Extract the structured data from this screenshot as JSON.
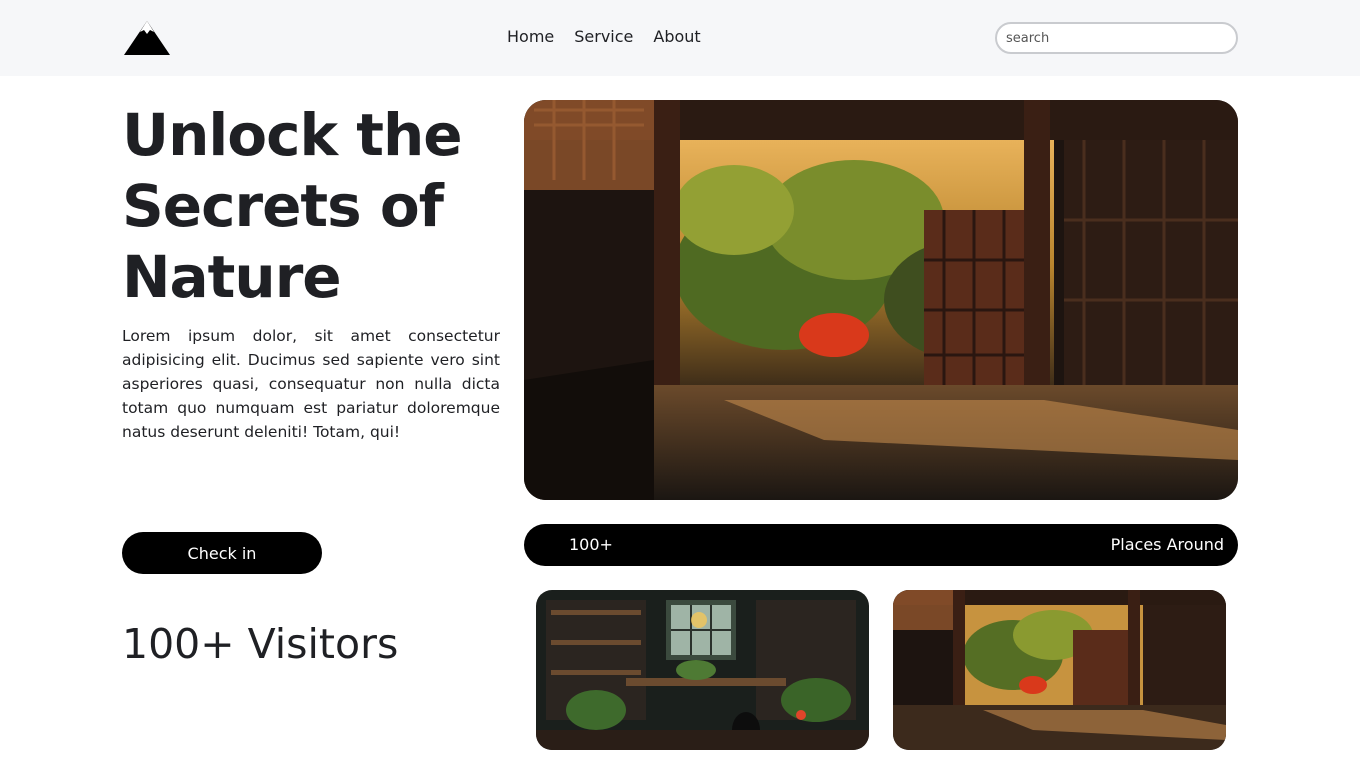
{
  "header": {
    "logo": "mountain-logo",
    "nav": [
      "Home",
      "Service",
      "About"
    ],
    "search_placeholder": "search"
  },
  "hero": {
    "title": "Unlock the Secrets of Nature",
    "description": "Lorem ipsum dolor, sit amet consectetur adipisicing elit. Ducimus sed sapiente vero sint asperiores quasi, consequatur non nulla dicta totam quo numquam est pariatur doloremque natus deserunt deleniti! Totam, qui!",
    "button_label": "Check in",
    "visitors": "100+ Visitors"
  },
  "stats": {
    "count": "100+",
    "label": "Places Around"
  },
  "colors": {
    "header_bg": "#f6f7f9",
    "text": "#1f2024",
    "button_bg": "#000000"
  }
}
